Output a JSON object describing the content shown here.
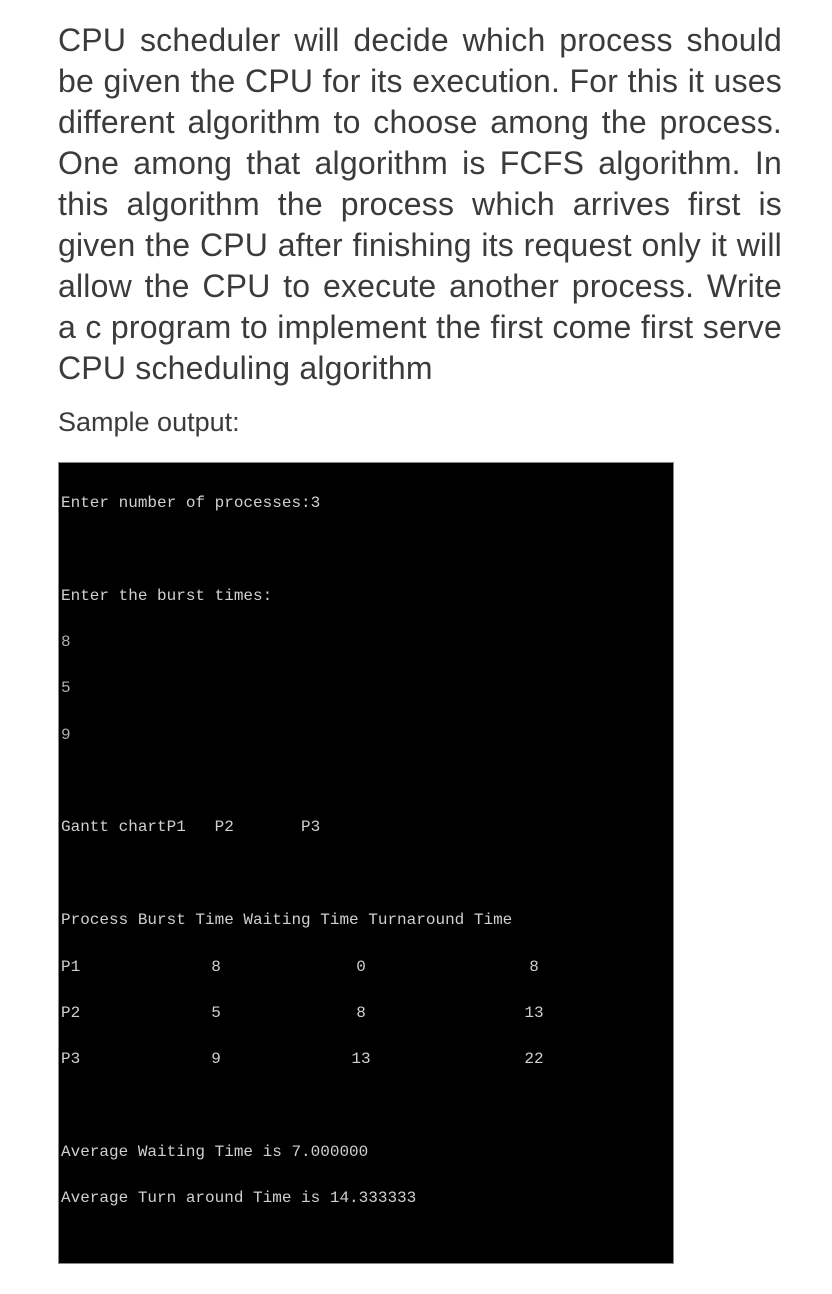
{
  "question": "CPU scheduler will decide which process should be given the CPU for its execution. For this it uses different algorithm to choose among the process. One among that algorithm is FCFS algorithm. In this algorithm the process which arrives first is given the CPU after finishing its request only it will allow the CPU to execute another process. Write a c program to implement the first come first serve CPU scheduling algorithm",
  "sample_label": "Sample output:",
  "terminal": {
    "enter_processes": "Enter number of processes:3",
    "enter_burst": "Enter the burst times:",
    "burst_inputs": [
      "8",
      "5",
      "9"
    ],
    "gantt_line": "Gantt chartP1   P2       P3",
    "table_header": "Process Burst Time Waiting Time Turnaround Time",
    "rows": [
      {
        "p": "P1",
        "burst": "8",
        "wait": "0",
        "turn": "8"
      },
      {
        "p": "P2",
        "burst": "5",
        "wait": "8",
        "turn": "13"
      },
      {
        "p": "P3",
        "burst": "9",
        "wait": "13",
        "turn": "22"
      }
    ],
    "avg_wait": "Average Waiting Time is 7.000000",
    "avg_turn": "Average Turn around Time is 14.333333"
  }
}
